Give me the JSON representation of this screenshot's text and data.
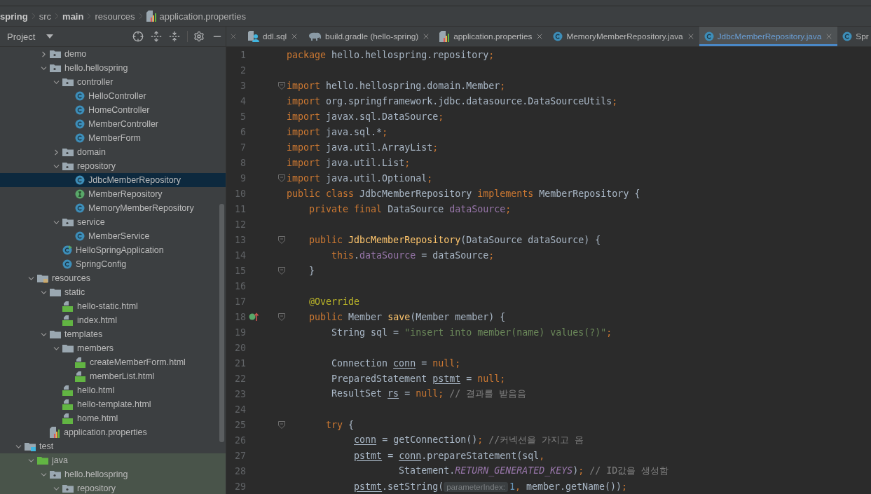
{
  "breadcrumb": [
    {
      "label": "spring",
      "bold": true,
      "kind": "module"
    },
    {
      "label": "src",
      "bold": false,
      "kind": "folder"
    },
    {
      "label": "main",
      "bold": true,
      "kind": "folder"
    },
    {
      "label": "resources",
      "bold": false,
      "kind": "folder"
    },
    {
      "label": "application.properties",
      "bold": false,
      "kind": "properties"
    }
  ],
  "project_panel": {
    "title": "Project"
  },
  "tree": {
    "items": [
      {
        "children": [
          {
            "children": [
              {
                "label": "demo",
                "kind": "package",
                "expanded": false,
                "selected": false
              },
              {
                "label": "hello.hellospring",
                "kind": "package",
                "expanded": true,
                "selected": false,
                "children": [
                  {
                    "label": "controller",
                    "kind": "package",
                    "expanded": true,
                    "selected": false,
                    "children": [
                      {
                        "label": "HelloController",
                        "kind": "class",
                        "selected": false
                      },
                      {
                        "label": "HomeController",
                        "kind": "class",
                        "selected": false
                      },
                      {
                        "label": "MemberController",
                        "kind": "class",
                        "selected": false
                      },
                      {
                        "label": "MemberForm",
                        "kind": "class",
                        "selected": false
                      }
                    ]
                  },
                  {
                    "label": "domain",
                    "kind": "package",
                    "expanded": false,
                    "selected": false
                  },
                  {
                    "label": "repository",
                    "kind": "package",
                    "expanded": true,
                    "selected": false,
                    "children": [
                      {
                        "label": "JdbcMemberRepository",
                        "kind": "class",
                        "selected": true
                      },
                      {
                        "label": "MemberRepository",
                        "kind": "interface",
                        "selected": false
                      },
                      {
                        "label": "MemoryMemberRepository",
                        "kind": "class",
                        "selected": false
                      }
                    ]
                  },
                  {
                    "label": "service",
                    "kind": "package",
                    "expanded": true,
                    "selected": false,
                    "children": [
                      {
                        "label": "MemberService",
                        "kind": "class",
                        "selected": false
                      }
                    ]
                  },
                  {
                    "label": "HelloSpringApplication",
                    "kind": "app",
                    "selected": false
                  },
                  {
                    "label": "SpringConfig",
                    "kind": "class",
                    "selected": false
                  }
                ]
              }
            ]
          },
          {
            "label": "resources",
            "kind": "resources",
            "expanded": true,
            "selected": false,
            "children": [
              {
                "label": "static",
                "kind": "folder",
                "expanded": true,
                "selected": false,
                "children": [
                  {
                    "label": "hello-static.html",
                    "kind": "html",
                    "selected": false
                  },
                  {
                    "label": "index.html",
                    "kind": "html",
                    "selected": false
                  }
                ]
              },
              {
                "label": "templates",
                "kind": "folder",
                "expanded": true,
                "selected": false,
                "children": [
                  {
                    "label": "members",
                    "kind": "folder",
                    "expanded": true,
                    "selected": false,
                    "children": [
                      {
                        "label": "createMemberForm.html",
                        "kind": "html",
                        "selected": false
                      },
                      {
                        "label": "memberList.html",
                        "kind": "html",
                        "selected": false
                      }
                    ]
                  },
                  {
                    "label": "hello.html",
                    "kind": "html",
                    "selected": false
                  },
                  {
                    "label": "hello-template.html",
                    "kind": "html",
                    "selected": false
                  },
                  {
                    "label": "home.html",
                    "kind": "html",
                    "selected": false
                  }
                ]
              },
              {
                "label": "application.properties",
                "kind": "properties",
                "selected": false
              }
            ]
          }
        ]
      },
      {
        "label": "test",
        "kind": "test",
        "expanded": true,
        "selected": false,
        "children": [
          {
            "label": "java",
            "kind": "test-source",
            "expanded": true,
            "selected": false,
            "children": [
              {
                "label": "hello.hellospring",
                "kind": "package",
                "expanded": true,
                "selected": false,
                "children": [
                  {
                    "label": "repository",
                    "kind": "package",
                    "expanded": true,
                    "selected": false
                  }
                ]
              }
            ]
          }
        ]
      }
    ]
  },
  "tabs": [
    {
      "label": "ddl.sql",
      "kind": "sql",
      "selected": false
    },
    {
      "label": "build.gradle (hello-spring)",
      "kind": "gradle",
      "selected": false
    },
    {
      "label": "application.properties",
      "kind": "properties",
      "selected": false
    },
    {
      "label": "MemoryMemberRepository.java",
      "kind": "class",
      "selected": false
    },
    {
      "label": "JdbcMemberRepository.java",
      "kind": "class",
      "selected": true
    },
    {
      "label": "Spr",
      "kind": "class",
      "selected": false
    }
  ],
  "code": {
    "lines": [
      {
        "number": "1",
        "fold": false,
        "override": false,
        "tokens": [
          {
            "kind": "keyword",
            "text": "package"
          },
          {
            "kind": "plain",
            "text": " hello.hellospring.repository"
          },
          {
            "kind": "keyword",
            "text": ";"
          }
        ]
      },
      {
        "number": "2",
        "fold": false,
        "override": false
      },
      {
        "number": "3",
        "fold": true,
        "override": false,
        "tokens": [
          {
            "kind": "keyword",
            "text": "import"
          },
          {
            "kind": "plain",
            "text": " hello.hellospring.domain.Member"
          },
          {
            "kind": "keyword",
            "text": ";"
          }
        ]
      },
      {
        "number": "4",
        "fold": false,
        "override": false,
        "tokens": [
          {
            "kind": "keyword",
            "text": "import"
          },
          {
            "kind": "plain",
            "text": " org.springframework.jdbc.datasource.DataSourceUtils"
          },
          {
            "kind": "keyword",
            "text": ";"
          }
        ]
      },
      {
        "number": "5",
        "fold": false,
        "override": false,
        "tokens": [
          {
            "kind": "keyword",
            "text": "import"
          },
          {
            "kind": "plain",
            "text": " javax.sql.DataSource"
          },
          {
            "kind": "keyword",
            "text": ";"
          }
        ]
      },
      {
        "number": "6",
        "fold": false,
        "override": false,
        "tokens": [
          {
            "kind": "keyword",
            "text": "import"
          },
          {
            "kind": "plain",
            "text": " java.sql.*"
          },
          {
            "kind": "keyword",
            "text": ";"
          }
        ]
      },
      {
        "number": "7",
        "fold": false,
        "override": false,
        "tokens": [
          {
            "kind": "keyword",
            "text": "import"
          },
          {
            "kind": "plain",
            "text": " java.util.ArrayList"
          },
          {
            "kind": "keyword",
            "text": ";"
          }
        ]
      },
      {
        "number": "8",
        "fold": false,
        "override": false,
        "tokens": [
          {
            "kind": "keyword",
            "text": "import"
          },
          {
            "kind": "plain",
            "text": " java.util.List"
          },
          {
            "kind": "keyword",
            "text": ";"
          }
        ]
      },
      {
        "number": "9",
        "fold": true,
        "override": false,
        "tokens": [
          {
            "kind": "keyword",
            "text": "import"
          },
          {
            "kind": "plain",
            "text": " java.util.Optional"
          },
          {
            "kind": "keyword",
            "text": ";"
          }
        ]
      },
      {
        "number": "10",
        "fold": false,
        "override": false,
        "tokens": [
          {
            "kind": "keyword",
            "text": "public class"
          },
          {
            "kind": "plain",
            "text": " JdbcMemberRepository "
          },
          {
            "kind": "keyword",
            "text": "implements"
          },
          {
            "kind": "plain",
            "text": " MemberRepository {"
          }
        ]
      },
      {
        "number": "11",
        "fold": false,
        "override": false,
        "tokens": [
          {
            "kind": "keyword",
            "text": "    private final"
          },
          {
            "kind": "plain",
            "text": " DataSource "
          },
          {
            "kind": "field",
            "text": "dataSource"
          },
          {
            "kind": "keyword",
            "text": ";"
          }
        ]
      },
      {
        "number": "12",
        "fold": false,
        "override": false
      },
      {
        "number": "13",
        "fold": true,
        "override": false,
        "tokens": [
          {
            "kind": "keyword",
            "text": "    public "
          },
          {
            "kind": "method",
            "text": "JdbcMemberRepository"
          },
          {
            "kind": "plain",
            "text": "(DataSource dataSource) {"
          }
        ]
      },
      {
        "number": "14",
        "fold": false,
        "override": false,
        "tokens": [
          {
            "kind": "keyword",
            "text": "        this"
          },
          {
            "kind": "plain",
            "text": "."
          },
          {
            "kind": "field",
            "text": "dataSource"
          },
          {
            "kind": "plain",
            "text": " = dataSource"
          },
          {
            "kind": "keyword",
            "text": ";"
          }
        ]
      },
      {
        "number": "15",
        "fold": true,
        "override": false,
        "tokens": [
          {
            "kind": "plain",
            "text": "    }"
          }
        ]
      },
      {
        "number": "16",
        "fold": false,
        "override": false
      },
      {
        "number": "17",
        "fold": false,
        "override": false,
        "tokens": [
          {
            "kind": "annotation",
            "text": "    @Override"
          }
        ]
      },
      {
        "number": "18",
        "fold": true,
        "override": true,
        "tokens": [
          {
            "kind": "keyword",
            "text": "    public"
          },
          {
            "kind": "plain",
            "text": " Member "
          },
          {
            "kind": "method",
            "text": "save"
          },
          {
            "kind": "plain",
            "text": "(Member member) {"
          }
        ]
      },
      {
        "number": "19",
        "fold": false,
        "override": false,
        "tokens": [
          {
            "kind": "plain",
            "text": "        String sql = "
          },
          {
            "kind": "string",
            "text": "\"insert into member(name) values(?)\""
          },
          {
            "kind": "keyword",
            "text": ";"
          }
        ]
      },
      {
        "number": "20",
        "fold": false,
        "override": false
      },
      {
        "number": "21",
        "fold": false,
        "override": false,
        "tokens": [
          {
            "kind": "plain",
            "text": "        Connection "
          },
          {
            "kind": "variable",
            "text": "conn"
          },
          {
            "kind": "plain",
            "text": " = "
          },
          {
            "kind": "keyword",
            "text": "null;"
          }
        ]
      },
      {
        "number": "22",
        "fold": false,
        "override": false,
        "tokens": [
          {
            "kind": "plain",
            "text": "        PreparedStatement "
          },
          {
            "kind": "variable",
            "text": "pstmt"
          },
          {
            "kind": "plain",
            "text": " = "
          },
          {
            "kind": "keyword",
            "text": "null;"
          }
        ]
      },
      {
        "number": "23",
        "fold": false,
        "override": false,
        "tokens": [
          {
            "kind": "plain",
            "text": "        ResultSet "
          },
          {
            "kind": "variable",
            "text": "rs"
          },
          {
            "kind": "plain",
            "text": " = "
          },
          {
            "kind": "keyword",
            "text": "null;"
          },
          {
            "kind": "comment",
            "text": " // 결과를 받음음"
          }
        ]
      },
      {
        "number": "24",
        "fold": false,
        "override": false
      },
      {
        "number": "25",
        "fold": true,
        "override": false,
        "tokens": [
          {
            "kind": "keyword",
            "text": "       try"
          },
          {
            "kind": "plain",
            "text": " {"
          }
        ]
      },
      {
        "number": "26",
        "fold": false,
        "override": false,
        "tokens": [
          {
            "kind": "variable",
            "text": "            conn"
          },
          {
            "kind": "plain",
            "text": " = getConnection()"
          },
          {
            "kind": "keyword",
            "text": ";"
          },
          {
            "kind": "comment",
            "text": " //커넥션을 가지고 옴"
          }
        ]
      },
      {
        "number": "27",
        "fold": false,
        "override": false,
        "tokens": [
          {
            "kind": "variable",
            "text": "            pstmt"
          },
          {
            "kind": "plain",
            "text": " = "
          },
          {
            "kind": "variable",
            "text": "conn"
          },
          {
            "kind": "plain",
            "text": ".prepareStatement(sql"
          },
          {
            "kind": "keyword",
            "text": ","
          }
        ]
      },
      {
        "number": "28",
        "fold": false,
        "override": false,
        "tokens": [
          {
            "kind": "plain",
            "text": "                    Statement."
          },
          {
            "kind": "constant",
            "text": "RETURN_GENERATED_KEYS"
          },
          {
            "kind": "plain",
            "text": ")"
          },
          {
            "kind": "keyword",
            "text": ";"
          },
          {
            "kind": "comment",
            "text": " // ID값을 생성함"
          }
        ]
      },
      {
        "number": "29",
        "fold": false,
        "override": false,
        "tokens": [
          {
            "kind": "variable",
            "text": "            pstmt"
          },
          {
            "kind": "plain",
            "text": ".setString("
          },
          {
            "kind": "hint",
            "text": "parameterIndex:"
          },
          {
            "kind": "number",
            "text": "1"
          },
          {
            "kind": "keyword",
            "text": ","
          },
          {
            "kind": "plain",
            "text": " member.getName())"
          },
          {
            "kind": "keyword",
            "text": ";"
          }
        ]
      }
    ]
  }
}
